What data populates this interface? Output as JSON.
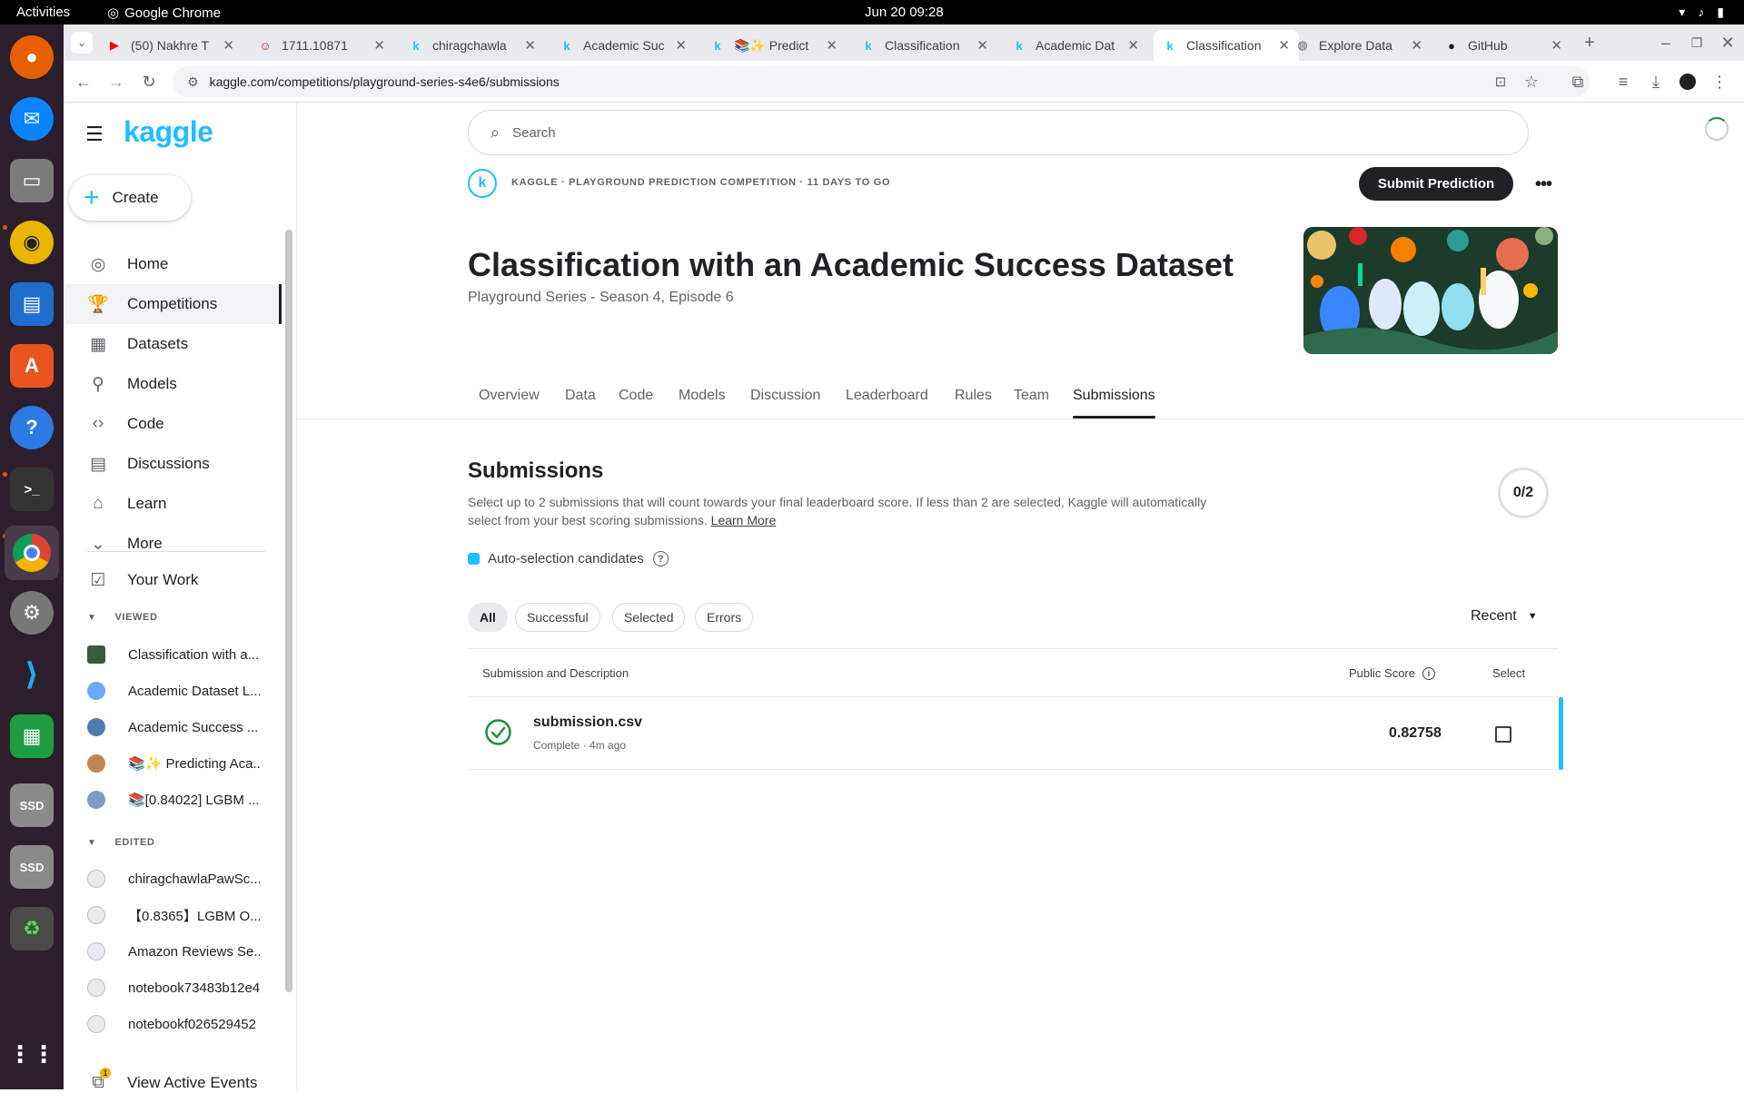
{
  "os": {
    "activities": "Activities",
    "app_name": "Google Chrome",
    "clock": "Jun 20  09:28"
  },
  "browser": {
    "tabs": [
      {
        "title": "(50) Nakhre T",
        "icon": "youtube-icon",
        "color": "#ff0000"
      },
      {
        "title": "1711.10871",
        "icon": "arxiv-icon",
        "color": "#b31b1b"
      },
      {
        "title": "chiragchawla",
        "icon": "kaggle-icon",
        "color": "#20beff"
      },
      {
        "title": "Academic Suc",
        "icon": "kaggle-icon",
        "color": "#20beff"
      },
      {
        "title": "📚✨ Predict",
        "icon": "kaggle-icon",
        "color": "#20beff"
      },
      {
        "title": "Classification",
        "icon": "kaggle-icon",
        "color": "#20beff"
      },
      {
        "title": "Academic Dat",
        "icon": "kaggle-icon",
        "color": "#20beff"
      },
      {
        "title": "Classification",
        "icon": "kaggle-icon",
        "color": "#20beff",
        "active": true
      },
      {
        "title": "Explore Data",
        "icon": "globe-icon",
        "color": "#5f6368"
      },
      {
        "title": "GitHub",
        "icon": "github-icon",
        "color": "#202124"
      }
    ],
    "url": "kaggle.com/competitions/playground-series-s4e6/submissions"
  },
  "sidebar": {
    "logo": "kaggle",
    "create_label": "Create",
    "nav": [
      {
        "label": "Home",
        "icon": "compass-icon"
      },
      {
        "label": "Competitions",
        "icon": "trophy-icon",
        "active": true
      },
      {
        "label": "Datasets",
        "icon": "table-icon"
      },
      {
        "label": "Models",
        "icon": "models-icon"
      },
      {
        "label": "Code",
        "icon": "code-icon"
      },
      {
        "label": "Discussions",
        "icon": "discussion-icon"
      },
      {
        "label": "Learn",
        "icon": "school-icon"
      },
      {
        "label": "More",
        "icon": "chevron-down-icon"
      }
    ],
    "your_work": "Your Work",
    "viewed_heading": "VIEWED",
    "viewed": [
      "Classification with a...",
      "Academic Dataset L...",
      "Academic Success ...",
      "📚✨ Predicting Aca...",
      "📚[0.84022] LGBM ..."
    ],
    "edited_heading": "EDITED",
    "edited": [
      "chiragchawlaPawSc...",
      "【0.8365】LGBM O...",
      "Amazon Reviews Se...",
      "notebook73483b12e4",
      "notebookf026529452"
    ],
    "view_active_events": "View Active Events",
    "events_badge": "1"
  },
  "competition": {
    "search_placeholder": "Search",
    "breadcrumb": "KAGGLE · PLAYGROUND PREDICTION COMPETITION · 11 DAYS TO GO",
    "submit_label": "Submit Prediction",
    "title": "Classification with an Academic Success Dataset",
    "subtitle": "Playground Series - Season 4, Episode 6",
    "tabs": [
      "Overview",
      "Data",
      "Code",
      "Models",
      "Discussion",
      "Leaderboard",
      "Rules",
      "Team",
      "Submissions"
    ],
    "active_tab": "Submissions"
  },
  "submissions": {
    "heading": "Submissions",
    "desc": "Select up to 2 submissions that will count towards your final leaderboard score. If less than 2 are selected, Kaggle will automatically select from your best scoring submissions.",
    "learn_more": "Learn More",
    "counter": "0/2",
    "auto_selection": "Auto-selection candidates",
    "filters": [
      "All",
      "Successful",
      "Selected",
      "Errors"
    ],
    "sort": "Recent",
    "col_submission": "Submission and Description",
    "col_score": "Public Score",
    "col_select": "Select",
    "rows": [
      {
        "file": "submission.csv",
        "status": "Complete",
        "time": "4m ago",
        "score": "0.82758",
        "selected": false
      }
    ]
  },
  "colors": {
    "kaggle_blue": "#20beff",
    "success_green": "#1e8e3e",
    "dark_button": "#202124"
  }
}
